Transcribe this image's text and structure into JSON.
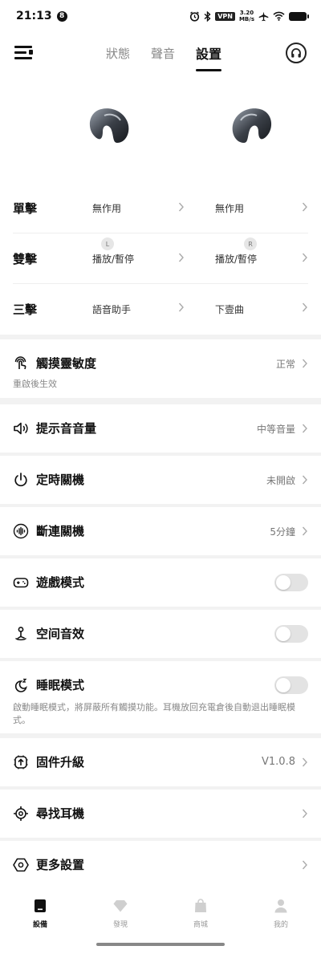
{
  "status_bar": {
    "time": "21:13",
    "notification_count": "8",
    "vpn": "VPN",
    "speed_value": "3.20",
    "speed_unit": "MB/s"
  },
  "header": {
    "tabs": [
      {
        "label": "狀態",
        "active": false
      },
      {
        "label": "聲音",
        "active": false
      },
      {
        "label": "設置",
        "active": true
      }
    ]
  },
  "earbuds": {
    "left_badge": "L",
    "right_badge": "R",
    "gestures": [
      {
        "label": "單擊",
        "left": "無作用",
        "right": "無作用"
      },
      {
        "label": "雙擊",
        "left": "播放/暫停",
        "right": "播放/暫停"
      },
      {
        "label": "三擊",
        "left": "語音助手",
        "right": "下壹曲"
      }
    ]
  },
  "settings": {
    "touch_sensitivity": {
      "title": "觸摸靈敏度",
      "value": "正常",
      "note": "重啟後生效"
    },
    "prompt_volume": {
      "title": "提示音音量",
      "value": "中等音量"
    },
    "timed_shutdown": {
      "title": "定時關機",
      "value": "未開啟"
    },
    "disconnect_shutdown": {
      "title": "斷連關機",
      "value": "5分鐘"
    },
    "game_mode": {
      "title": "遊戲模式",
      "enabled": false
    },
    "spatial_audio": {
      "title": "空间音效",
      "enabled": false
    },
    "sleep_mode": {
      "title": "睡眠模式",
      "enabled": false,
      "note": "啟動睡眠模式，將屏蔽所有觸摸功能。耳機放回充電倉後自動退出睡眠模式。"
    },
    "firmware": {
      "title": "固件升級",
      "value": "V1.0.8"
    },
    "find_earbuds": {
      "title": "尋找耳機"
    },
    "more_settings": {
      "title": "更多設置"
    }
  },
  "bottom_nav": [
    {
      "label": "設備",
      "icon": "device-icon",
      "active": true
    },
    {
      "label": "發現",
      "icon": "diamond-icon",
      "active": false
    },
    {
      "label": "商城",
      "icon": "shop-bag-icon",
      "active": false
    },
    {
      "label": "我的",
      "icon": "profile-icon",
      "active": false
    }
  ],
  "colors": {
    "accent": "#111111",
    "toggle_off": "#e3e3e3",
    "background": "#f2f2f2"
  }
}
